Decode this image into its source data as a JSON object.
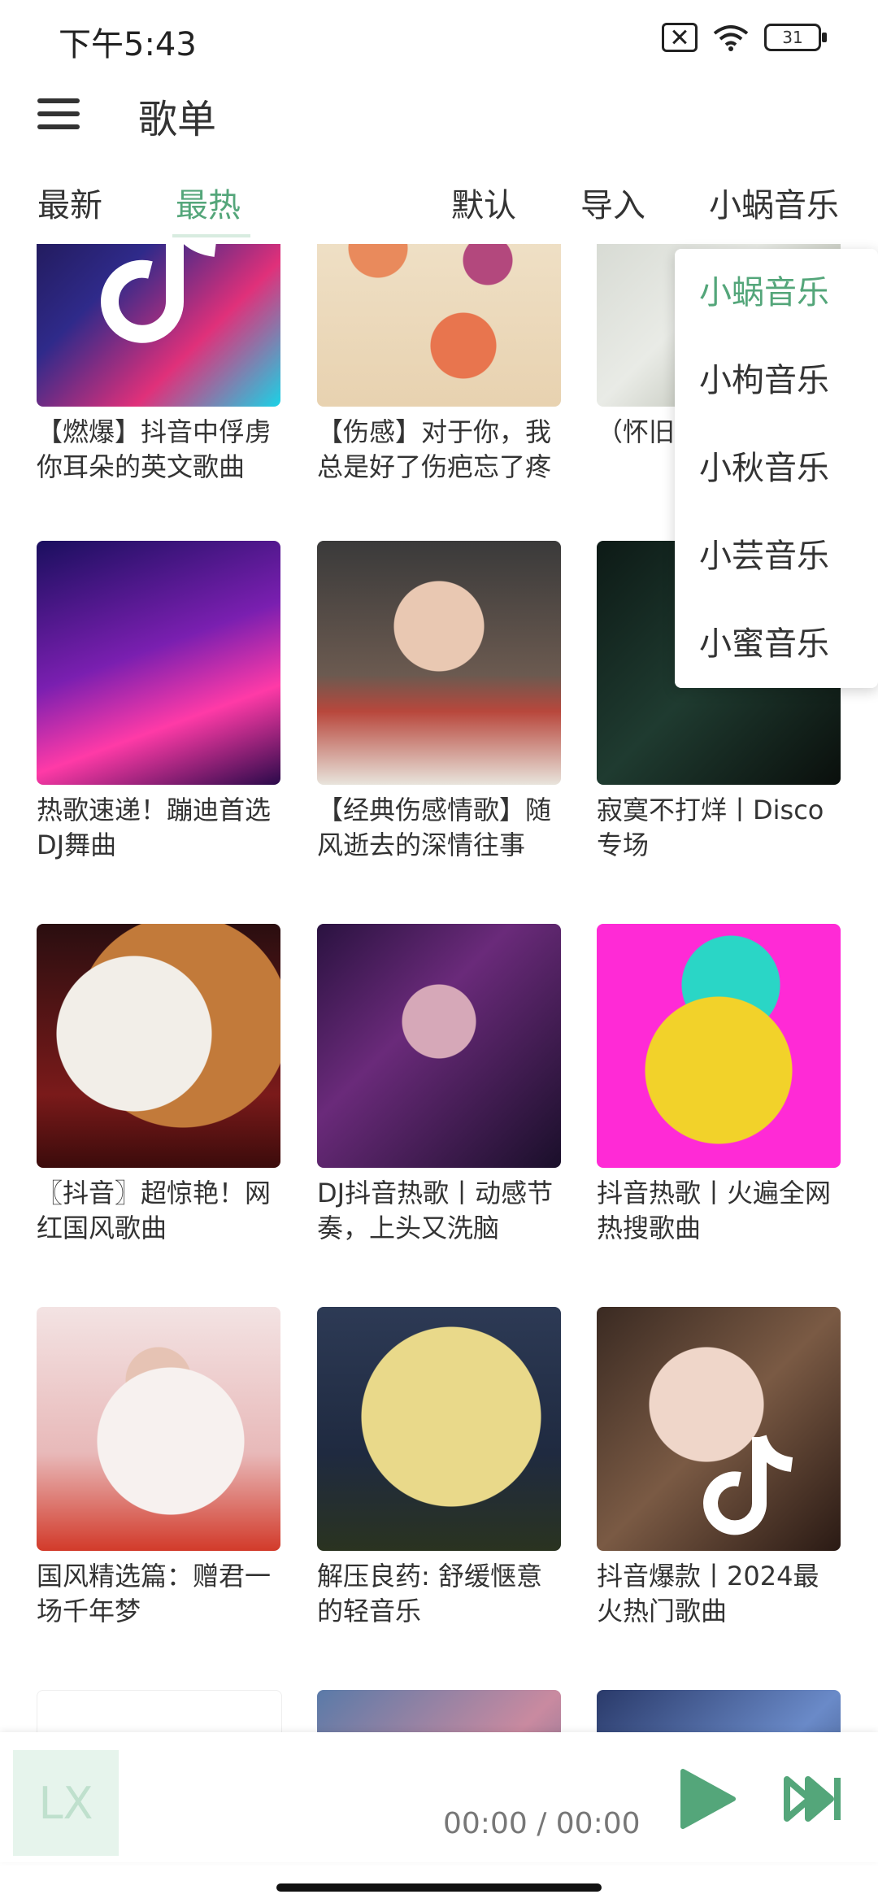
{
  "status_bar": {
    "time": "下午5:43",
    "battery": "31"
  },
  "app_bar": {
    "title": "歌单"
  },
  "tabs": {
    "left": [
      "最新",
      "最热"
    ],
    "active_index": 1,
    "right": [
      "默认",
      "导入",
      "小蜗音乐"
    ]
  },
  "dropdown": {
    "options": [
      "小蜗音乐",
      "小枸音乐",
      "小秋音乐",
      "小芸音乐",
      "小蜜音乐"
    ],
    "selected_index": 0
  },
  "playlists": [
    {
      "name": "【燃爆】抖音中俘虏你耳朵的英文歌曲"
    },
    {
      "name": "【伤感】对于你，我总是好了伤疤忘了疼"
    },
    {
      "name": "（怀旧勾起了"
    },
    {
      "name": "热歌速递！蹦迪首选DJ舞曲"
    },
    {
      "name": "【经典伤感情歌】随风逝去的深情往事"
    },
    {
      "name": "寂寞不打烊丨Disco专场"
    },
    {
      "name": "〖抖音〗超惊艳！网红国风歌曲"
    },
    {
      "name": "DJ抖音热歌丨动感节奏，上头又洗脑"
    },
    {
      "name": "抖音热歌丨火遍全网热搜歌曲"
    },
    {
      "name": "国风精选篇：赠君一场千年梦"
    },
    {
      "name": "解压良药: 舒缓惬意的轻音乐"
    },
    {
      "name": "抖音爆款丨2024最火热门歌曲"
    },
    {
      "name": ""
    },
    {
      "name": ""
    },
    {
      "name": ""
    }
  ],
  "player": {
    "logo": "LX",
    "time": "00:00 / 00:00"
  },
  "colors": {
    "accent": "#54a67a",
    "text": "#333333"
  }
}
